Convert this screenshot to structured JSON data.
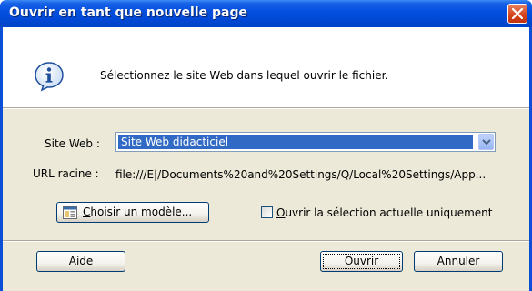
{
  "dialog": {
    "title": "Ouvrir en tant que nouvelle page",
    "message": "Sélectionnez le site Web dans lequel ouvrir le fichier."
  },
  "site": {
    "label": "Site Web :",
    "selected": "Site Web didacticiel"
  },
  "url": {
    "label": "URL racine :",
    "value": "file:///E|/Documents%20and%20Settings/Q/Local%20Settings/App..."
  },
  "buttons": {
    "template": "Choisir un modèle...",
    "help": "Aide",
    "open": "Ouvrir",
    "cancel": "Annuler"
  },
  "checkbox": {
    "label": "Ouvrir la sélection actuelle uniquement",
    "checked": false
  },
  "icons": {
    "info": "info-icon",
    "close": "close-icon",
    "dropdown": "chevron-down-icon",
    "template": "template-icon"
  },
  "colors": {
    "titlebar": "#0550e0",
    "selection": "#316ac5",
    "close": "#d6461c"
  }
}
